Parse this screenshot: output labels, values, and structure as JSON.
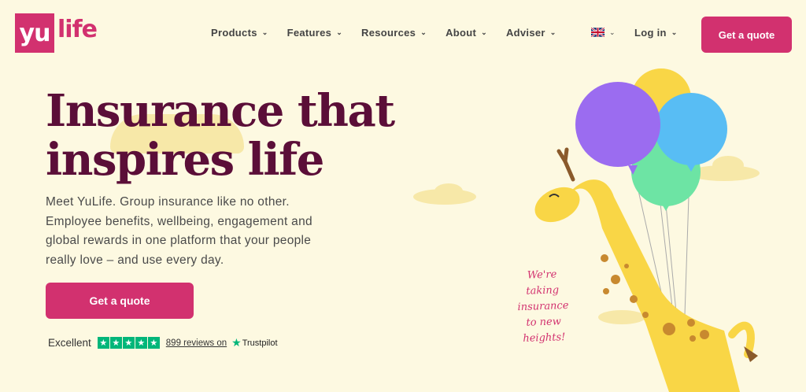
{
  "brand": {
    "logo_left": "yu",
    "logo_right": "life",
    "accent": "#d2316f",
    "title_color": "#5b0e38",
    "background": "#fdf9e1"
  },
  "nav": {
    "items": [
      {
        "label": "Products"
      },
      {
        "label": "Features"
      },
      {
        "label": "Resources"
      },
      {
        "label": "About"
      },
      {
        "label": "Adviser"
      }
    ],
    "language_icon": "uk-flag-icon",
    "login_label": "Log in",
    "cta_label": "Get a quote"
  },
  "hero": {
    "title": "Insurance that inspires life",
    "subtitle": "Meet YuLife. Group insurance like no other. Employee benefits, wellbeing, engagement and global rewards in one platform that your people really love – and use every day.",
    "cta_label": "Get a quote",
    "tagline": "We're taking insurance to new heights!"
  },
  "trustpilot": {
    "rating_label": "Excellent",
    "stars": 5,
    "reviews_text": "899 reviews on",
    "brand": "Trustpilot",
    "star_color": "#00b67a"
  }
}
